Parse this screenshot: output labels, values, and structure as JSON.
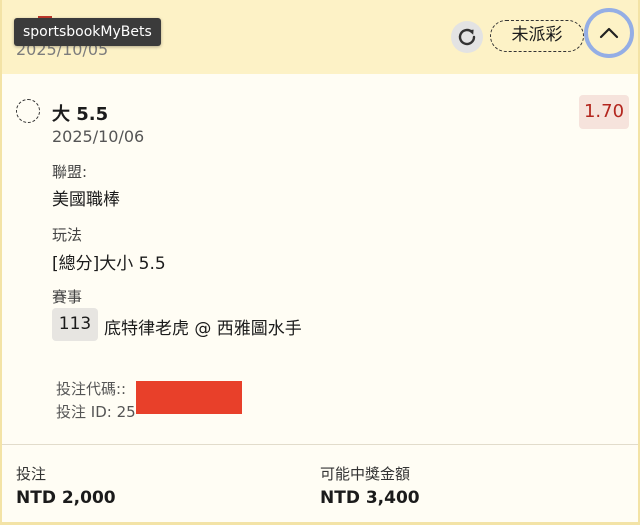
{
  "header": {
    "date": "2025/10/05",
    "tooltip": "sportsbookMyBets",
    "status": "未派彩"
  },
  "selection": {
    "title": "大 5.5",
    "date": "2025/10/06",
    "odds": "1.70"
  },
  "fields": {
    "league_label": "聯盟:",
    "league_value": "美國職棒",
    "bet_type_label": "玩法",
    "bet_type_value": "[總分]大小 5.5",
    "event_label": "賽事",
    "match_no": "113",
    "match_name": "底特律老虎 @ 西雅圖水手"
  },
  "refs": {
    "code_label": "投注代碼::",
    "id_label": "投注 ID: 25"
  },
  "footer": {
    "stake_label": "投注",
    "stake_value": "NTD 2,000",
    "payout_label": "可能中獎金額",
    "payout_value": "NTD 3,400"
  },
  "colors": {
    "header_bg": "#fdf2c6",
    "odds_text": "#b3261e",
    "odds_bg": "#f6e3dc",
    "redaction": "#e8402a",
    "focus_ring": "#94aee5"
  },
  "icons": {
    "refresh": "refresh-icon",
    "collapse": "chevron-up-icon",
    "radio": "radio-unselected-icon"
  }
}
